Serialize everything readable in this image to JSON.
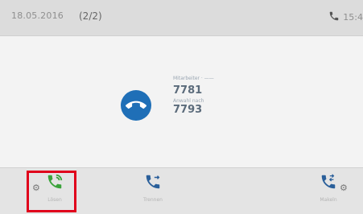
{
  "topbar": {
    "date": "18.05.2016",
    "page_indicator": "(2/2)",
    "time": "15:4"
  },
  "call": {
    "caller_name": "Mitarbeiter · ——",
    "caller_number": "7781",
    "transfer_label": "Anwahl nach",
    "target_number": "7793",
    "status_icon": "hangup-icon"
  },
  "softkeys": [
    {
      "label": "Lösen",
      "icon": "phone-call-icon",
      "color": "#3aa33a"
    },
    {
      "label": "Trennen",
      "icon": "phone-transfer-icon",
      "color": "#2a5f9a"
    },
    {
      "label": "Makeln",
      "icon": "phone-swap-icon",
      "color": "#2a5f9a"
    }
  ],
  "colors": {
    "accent": "#1f6fb7",
    "highlight": "#e0001b",
    "call_green": "#3aa33a"
  }
}
